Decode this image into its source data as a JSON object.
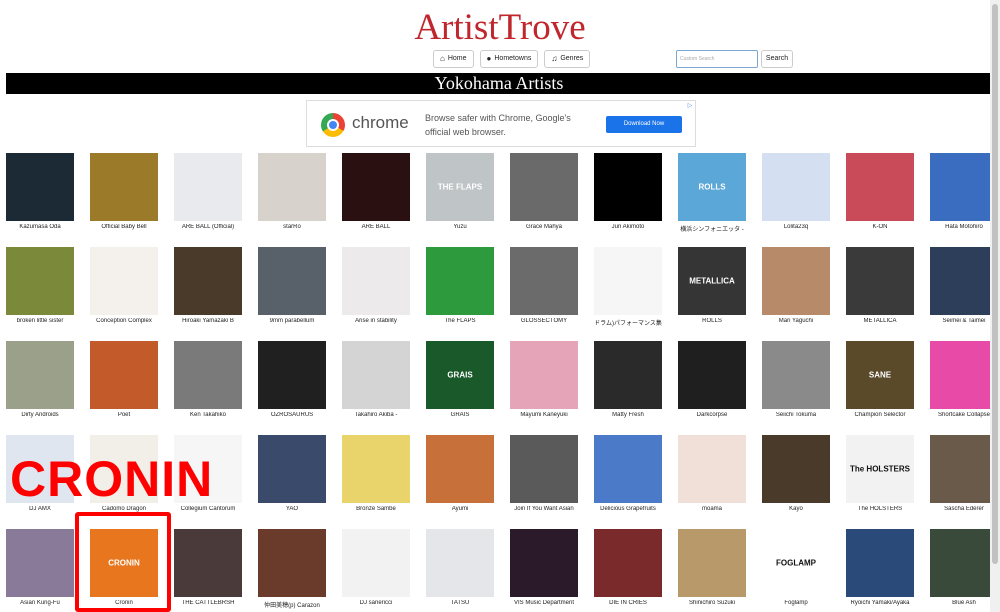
{
  "site": {
    "title": "ArtistTrove"
  },
  "nav": [
    {
      "label": "Home",
      "icon": "home-icon",
      "glyph": "⌂"
    },
    {
      "label": "Hometowns",
      "icon": "map-marker-icon",
      "glyph": "●"
    },
    {
      "label": "Genres",
      "icon": "music-note-icon",
      "glyph": "♫"
    }
  ],
  "search": {
    "placeholder": "Custom Search",
    "button_label": "Search"
  },
  "page_heading": "Yokohama Artists",
  "ad": {
    "brand": "chrome",
    "text": "Browse safer with Chrome, Google's official web browser.",
    "cta": "Download Now"
  },
  "artists": [
    {
      "name": "Kazumasa Oda",
      "color": "#1c2a36"
    },
    {
      "name": "Official Baby Bell",
      "color": "#9b7a2a"
    },
    {
      "name": "ARE BALL (Official)",
      "color": "#e8eaee"
    },
    {
      "name": "starRo",
      "color": "#d7d2cc"
    },
    {
      "name": "ARE BALL",
      "color": "#2a1010"
    },
    {
      "name": "Yuzu",
      "color": "#bfc4c7"
    },
    {
      "name": "Grace Mahya",
      "color": "#6a6a6a"
    },
    {
      "name": "Jun Akimoto",
      "color": "#000000"
    },
    {
      "name": "横浜シンフォニエッタ -",
      "color": "#5aa7d8"
    },
    {
      "name": "Lolita23q",
      "color": "#d5dff2"
    },
    {
      "name": "K-ON",
      "color": "#c94b5a"
    },
    {
      "name": "Hata Motohiro",
      "color": "#3a6cc0"
    },
    {
      "name": "broken little sister",
      "color": "#7a8a3a"
    },
    {
      "name": "Conception Complex",
      "color": "#f4f1ec"
    },
    {
      "name": "Hiroaki Yamazaki B",
      "color": "#4a3a2a"
    },
    {
      "name": "9mm parabellum",
      "color": "#58606a"
    },
    {
      "name": "Arise in stability",
      "color": "#eceaea"
    },
    {
      "name": "The FLAPS",
      "color": "#2e9a3e"
    },
    {
      "name": "GLOSSECTOMY",
      "color": "#6b6b6b"
    },
    {
      "name": "ドラム)パフォーマンス集",
      "color": "#f6f6f6"
    },
    {
      "name": "ROLLS",
      "color": "#353535"
    },
    {
      "name": "Mari Yaguchi",
      "color": "#b78a6a"
    },
    {
      "name": "METALLICA",
      "color": "#3a3a3a"
    },
    {
      "name": "Seimei & Taimei",
      "color": "#2d3e5a"
    },
    {
      "name": "Dirty Androids",
      "color": "#9aa08a"
    },
    {
      "name": "Poet",
      "color": "#c25a2a"
    },
    {
      "name": "Ken Takahiko",
      "color": "#7a7a7a"
    },
    {
      "name": "OZROSAURUS",
      "color": "#202020"
    },
    {
      "name": "Takahiro Akiba -",
      "color": "#d4d4d4"
    },
    {
      "name": "GRAIS",
      "color": "#1a5a2a"
    },
    {
      "name": "Mayumi Kaneyuki",
      "color": "#e6a4b8"
    },
    {
      "name": "Matty Fresh",
      "color": "#2a2a2a"
    },
    {
      "name": "Darkcorpse",
      "color": "#1f1f1f"
    },
    {
      "name": "Seiichi Tokuma",
      "color": "#8a8a8a"
    },
    {
      "name": "Champion Selector",
      "color": "#5a4a2a"
    },
    {
      "name": "Shortcake Collapse",
      "color": "#e84aa8"
    },
    {
      "name": "DJ AMX",
      "color": "#dfe6f0"
    },
    {
      "name": "Cadomo Dragon",
      "color": "#f2efe8"
    },
    {
      "name": "Collegium Cantorum",
      "color": "#f6f6f6"
    },
    {
      "name": "YAO",
      "color": "#3a4a6a"
    },
    {
      "name": "Bronze Sambe",
      "color": "#e8d46a"
    },
    {
      "name": "Ayumi",
      "color": "#c8703a"
    },
    {
      "name": "Join If You Want Asian",
      "color": "#5a5a5a"
    },
    {
      "name": "Delicious Grapefruits",
      "color": "#4a7ac8"
    },
    {
      "name": "moama",
      "color": "#f0e0d8"
    },
    {
      "name": "Kayo",
      "color": "#4a3a2a"
    },
    {
      "name": "The HOLSTERS",
      "color": "#f2f2f2"
    },
    {
      "name": "Sascha Ederer",
      "color": "#6a5a4a"
    },
    {
      "name": "Asian Kung-Fu",
      "color": "#8a7a9a"
    },
    {
      "name": "Cronin",
      "color": "#e8761e"
    },
    {
      "name": "THE CATTLEBRSH",
      "color": "#4a3a3a"
    },
    {
      "name": "仲田美穂(p) Carazon",
      "color": "#6a3a2a"
    },
    {
      "name": "DJ sanericci",
      "color": "#f2f2f2"
    },
    {
      "name": "TATSU",
      "color": "#e4e6ea"
    },
    {
      "name": "VIS Music Department",
      "color": "#2a1a2a"
    },
    {
      "name": "DIE IN CRIES",
      "color": "#7a2a2a"
    },
    {
      "name": "Shinichiro Suzuki",
      "color": "#b89a6a"
    },
    {
      "name": "Foglamp",
      "color": "#ffffff"
    },
    {
      "name": "Ryoichi Yamaki/Ayaka",
      "color": "#2a4a7a"
    },
    {
      "name": "Blue Ash",
      "color": "#3a4a3a"
    }
  ],
  "thumb_labels": {
    "5": "THE FLAPS",
    "8": "ROLLS",
    "20": "METALLICA",
    "29": "GRAIS",
    "34": "SANE",
    "49": "CRONIN",
    "46": "The HOLSTERS",
    "57": "FOGLAMP"
  },
  "overlay": {
    "text": "CRONIN"
  }
}
